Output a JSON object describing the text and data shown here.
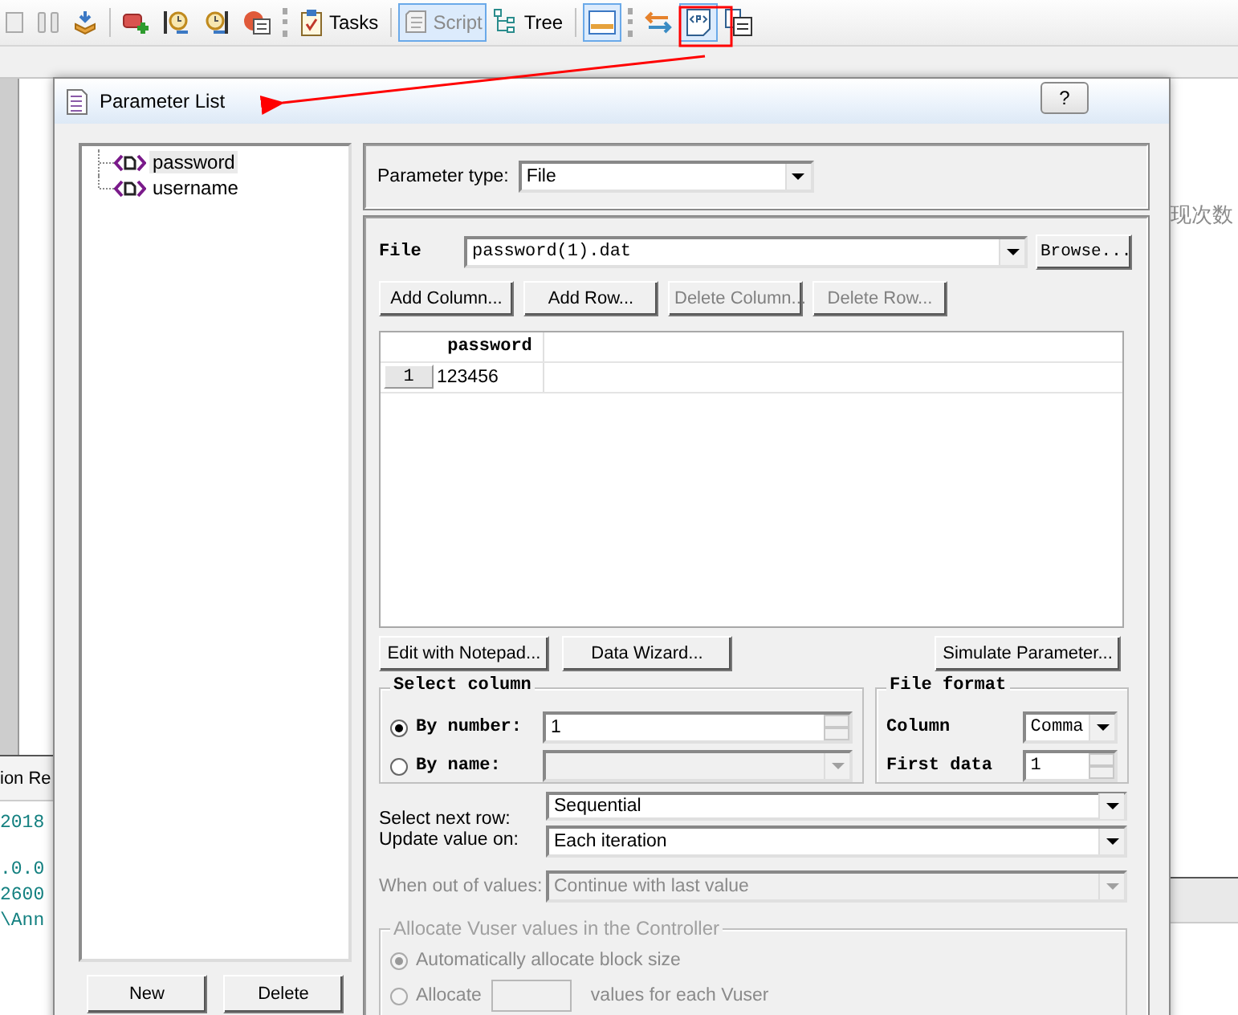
{
  "toolbar": [
    {
      "kind": "icon",
      "selected": false
    },
    {
      "kind": "icon",
      "selected": false
    },
    {
      "kind": "icon",
      "selected": false
    },
    {
      "kind": "separator"
    },
    {
      "kind": "icon",
      "selected": false
    },
    {
      "kind": "icon",
      "selected": false
    },
    {
      "kind": "icon",
      "selected": false
    },
    {
      "kind": "icon",
      "selected": false
    },
    {
      "kind": "grip"
    },
    {
      "kind": "labeled",
      "label": "Tasks",
      "selected": false
    },
    {
      "kind": "separator"
    },
    {
      "kind": "labeled",
      "label": "Script",
      "selected": true
    },
    {
      "kind": "labeled",
      "label": "Tree",
      "selected": false
    },
    {
      "kind": "separator"
    },
    {
      "kind": "icon",
      "selected": true
    },
    {
      "kind": "grip"
    },
    {
      "kind": "icon",
      "selected": false
    },
    {
      "kind": "icon",
      "selected": true
    },
    {
      "kind": "icon",
      "selected": false
    }
  ],
  "background": {
    "bottom_tab": "ion Re",
    "output_blocks": [
      [
        "2018"
      ],
      [
        ".0.0",
        "2600",
        "\\Ann"
      ]
    ],
    "side_text": "现次数"
  },
  "dialog": {
    "title": "Parameter List",
    "help": "?",
    "parameters": [
      {
        "name": "password",
        "selected": true
      },
      {
        "name": "username",
        "selected": false
      }
    ],
    "list_buttons": [
      "New",
      "Delete"
    ],
    "parameter_type": {
      "label": "Parameter type:",
      "value": "File"
    },
    "file": {
      "label": "File",
      "value": "password(1).dat",
      "browse": "Browse..."
    },
    "table_buttons": [
      {
        "label": "Add Column...",
        "disabled": false
      },
      {
        "label": "Add Row...",
        "disabled": false
      },
      {
        "label": "Delete Column...",
        "disabled": true
      },
      {
        "label": "Delete Row...",
        "disabled": true
      }
    ],
    "table": {
      "columns": [
        "password"
      ],
      "rows": [
        {
          "number": "1",
          "cells": [
            "123456"
          ]
        }
      ]
    },
    "action_buttons": [
      "Edit with Notepad...",
      "Data Wizard...",
      "Simulate Parameter..."
    ],
    "select_column": {
      "title": "Select column",
      "options": [
        {
          "label": "By number:",
          "selected": true,
          "value": "1",
          "disabled": false
        },
        {
          "label": "By name:",
          "selected": false,
          "disabled": true
        }
      ]
    },
    "file_format": {
      "title": "File format",
      "column": {
        "label": "Column",
        "value": "Comma"
      },
      "first_data": {
        "label": "First data",
        "value": "1"
      }
    },
    "select_next_row": {
      "label": "Select next row:",
      "value": "Sequential"
    },
    "update_value_on": {
      "label": "Update value on:",
      "value": "Each iteration"
    },
    "when_out_of_values": {
      "label": "When out of values:",
      "value": "Continue with last value",
      "disabled": true
    },
    "allocate": {
      "title": "Allocate Vuser values in the Controller",
      "disabled": true,
      "options": [
        {
          "label": "Automatically allocate block size",
          "selected": true
        },
        {
          "label": "Allocate",
          "suffix": "values for each Vuser",
          "selected": false
        }
      ]
    }
  }
}
